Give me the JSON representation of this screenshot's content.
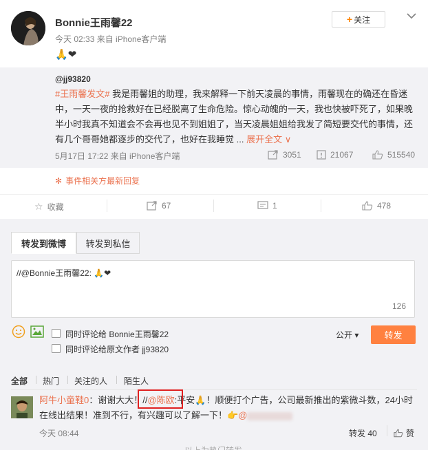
{
  "post": {
    "username": "Bonnie王雨馨22",
    "meta": "今天 02:33 来自 iPhone客户端",
    "follow_label": "关注",
    "emoji_text": "🙏❤"
  },
  "original": {
    "user": "@jj93820",
    "topic": "#王雨馨发文#",
    "text": " 我是雨馨姐的助理，我来解释一下前天凌晨的事情，雨馨现在的确还在昏迷中，一天一夜的抢救好在已经脱离了生命危险。惊心动魄的一天，我也快被吓死了，如果晚半小时我真不知道会不会再也见不到姐姐了，当天凌晨姐姐给我发了简短要交代的事情，还有几个哥哥她都逐步的交代了，也好在我睡觉 ...",
    "expand_label": "展开全文 ∨",
    "meta": "5月17日 17:22 来自 iPhone客户端",
    "reposts": "3051",
    "comments": "21067",
    "likes": "515540"
  },
  "related": {
    "label": "事件相关方最新回复"
  },
  "actions": {
    "favorite": "收藏",
    "repost": "67",
    "comment": "1",
    "like": "478"
  },
  "forward": {
    "tab_weibo": "转发到微博",
    "tab_private": "转发到私信",
    "input_value": "//@Bonnie王雨馨22: 🙏❤",
    "char_count": "126",
    "check1": "同时评论给 Bonnie王雨馨22",
    "check2": "同时评论给原文作者 jj93820",
    "visibility": "公开 ▾",
    "submit": "转发"
  },
  "filters": [
    "全部",
    "热门",
    "关注的人",
    "陌生人"
  ],
  "comment": {
    "user": "阿牛小童鞋0",
    "text_a": "：谢谢大大！//",
    "mention": "@陈欧",
    "text_b": ":平安🙏！顺便打个广告，公司最新推出的紫微斗数，24小时在线出结果！准到不行，有兴趣可以了解一下！👉",
    "mention2": "@",
    "time": "今天 08:44",
    "repost": "转发 40",
    "like": "赞"
  },
  "footer": {
    "partial": "以上为热门转发"
  },
  "colors": {
    "accent": "#eb7350",
    "button": "#ff8140",
    "panel": "#f2f2f5"
  }
}
